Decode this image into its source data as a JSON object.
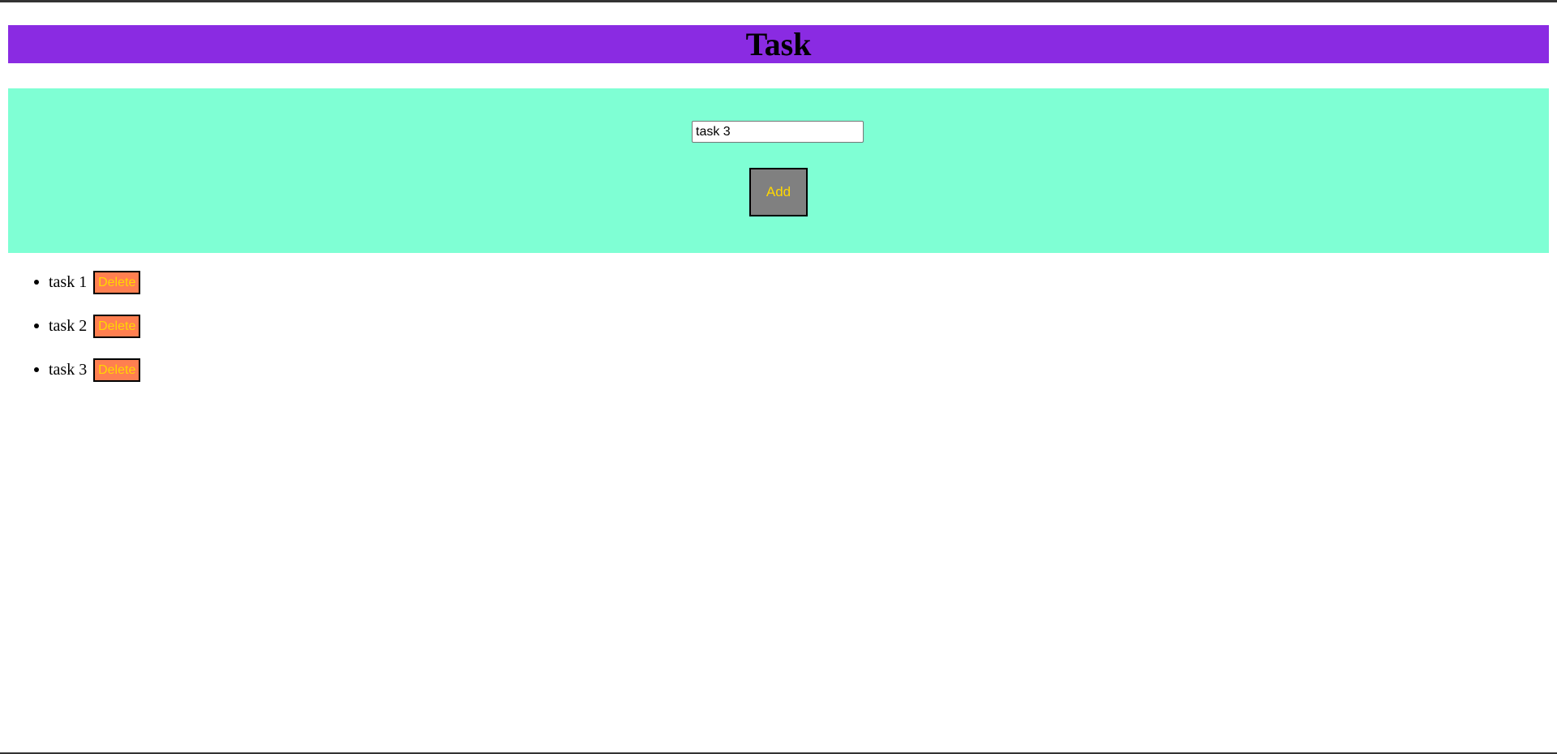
{
  "header": {
    "title": "Task"
  },
  "form": {
    "input_value": "task 3",
    "add_label": "Add"
  },
  "tasks": [
    {
      "text": "task 1",
      "delete_label": "Delete"
    },
    {
      "text": "task 2",
      "delete_label": "Delete"
    },
    {
      "text": "task 3",
      "delete_label": "Delete"
    }
  ],
  "colors": {
    "header_bg": "#8a2be2",
    "panel_bg": "#7fffd4",
    "add_button_bg": "#808080",
    "delete_button_bg": "#ff7f50",
    "button_text": "#ffd700"
  }
}
